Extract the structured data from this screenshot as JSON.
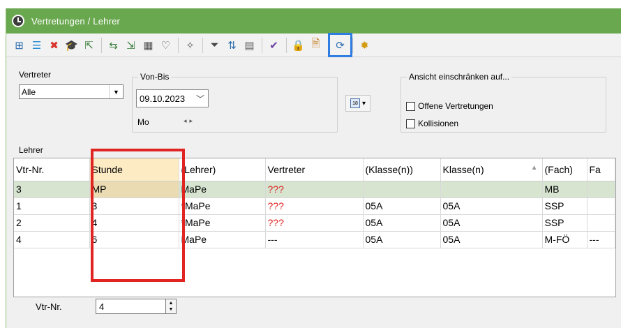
{
  "window": {
    "title": "Vertretungen / Lehrer"
  },
  "toolbar": {
    "buttons": [
      {
        "icon": "tree-expand-icon",
        "glyph": "⊞",
        "color": "#2b6cb0"
      },
      {
        "icon": "list-icon",
        "glyph": "☰",
        "color": "#2b8fd6"
      },
      {
        "icon": "delete-icon",
        "glyph": "✖",
        "color": "#d9342b"
      },
      {
        "icon": "graduation-cap-icon",
        "glyph": "🎓",
        "color": "#333333"
      },
      {
        "icon": "import-icon",
        "glyph": "⇱",
        "color": "#3a7d3a"
      },
      {
        "sep": true
      },
      {
        "icon": "swap-icon",
        "glyph": "⇆",
        "color": "#3a7d3a"
      },
      {
        "icon": "export-icon",
        "glyph": "⇲",
        "color": "#3a7d3a"
      },
      {
        "icon": "calculator-icon",
        "glyph": "▦",
        "color": "#555555"
      },
      {
        "icon": "stethoscope-icon",
        "glyph": "♡",
        "color": "#555555"
      },
      {
        "sep": true
      },
      {
        "icon": "wand-icon",
        "glyph": "✧",
        "color": "#666666"
      },
      {
        "sep": true
      },
      {
        "icon": "filter-icon",
        "glyph": "⏷",
        "color": "#444444"
      },
      {
        "icon": "sort-icon",
        "glyph": "⇅",
        "color": "#2b6cb0"
      },
      {
        "icon": "grid-icon",
        "glyph": "▤",
        "color": "#666666"
      },
      {
        "sep": true
      },
      {
        "icon": "edit-check-icon",
        "glyph": "✔",
        "color": "#6a3fa0"
      },
      {
        "sep": true
      },
      {
        "icon": "lock-icon",
        "glyph": "🔒",
        "color": "#c89b1a"
      },
      {
        "icon": "document-settings-icon",
        "glyph": "🗎",
        "color": "#c0781a"
      },
      {
        "sep": true
      },
      {
        "icon": "refresh-icon",
        "glyph": "⟳",
        "color": "#2b6cb0",
        "highlight": true
      },
      {
        "sep": true
      },
      {
        "icon": "gear-icon",
        "glyph": "✹",
        "color": "#d39b10"
      }
    ]
  },
  "filters": {
    "vertreter_label": "Vertreter",
    "vertreter_value": "Alle",
    "vonbis_label": "Von-Bis",
    "date_value": "09.10.2023",
    "day_label": "Mo",
    "ansicht_label": "Ansicht einschränken auf...",
    "offene_label": "Offene Vertretungen",
    "kollisionen_label": "Kollisionen",
    "offene_checked": false,
    "kollisionen_checked": false,
    "lehrer_label": "Lehrer",
    "calendar_glyph": "18"
  },
  "grid": {
    "columns": [
      "Vtr-Nr.",
      "Stunde",
      "(Lehrer)",
      "Vertreter",
      "(Klasse(n))",
      "Klasse(n)",
      "(Fach)",
      "Fa"
    ],
    "rows": [
      [
        "3",
        "MP",
        "MaPe",
        "???",
        "",
        "",
        "MB",
        ""
      ],
      [
        "1",
        "3",
        "*MaPe",
        "???",
        "05A",
        "05A",
        "SSP",
        ""
      ],
      [
        "2",
        "4",
        "*MaPe",
        "???",
        "05A",
        "05A",
        "SSP",
        ""
      ],
      [
        "4",
        "6",
        "MaPe",
        "---",
        "05A",
        "05A",
        "M-FÖ",
        "---"
      ]
    ],
    "selected_row": 0,
    "sorted_column": 5
  },
  "footer": {
    "vtr_label": "Vtr-Nr.",
    "vtr_value": "4"
  }
}
